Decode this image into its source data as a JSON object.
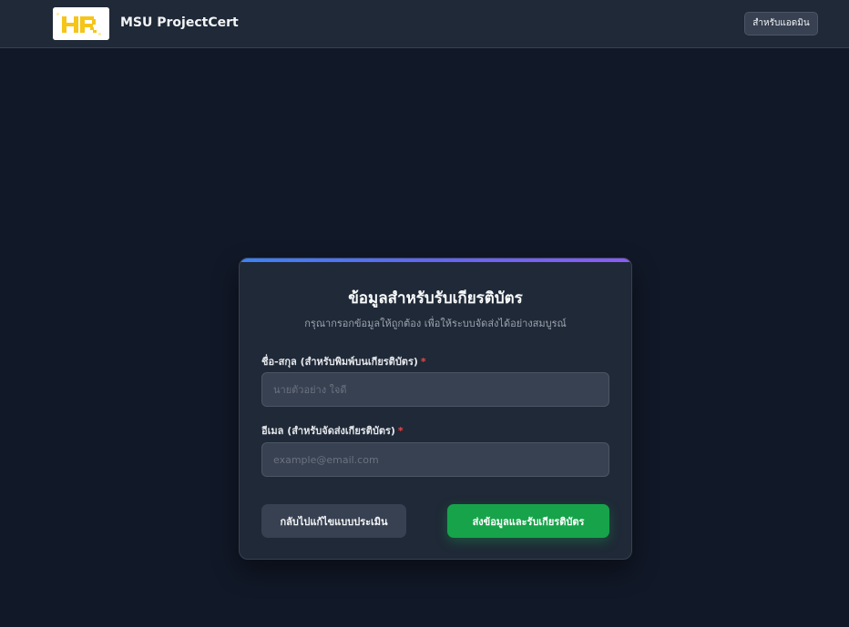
{
  "header": {
    "brand": "MSU ProjectCert",
    "logo_text": "HR",
    "admin_button": "สำหรับแอดมิน"
  },
  "form": {
    "title": "ข้อมูลสำหรับรับเกียรติบัตร",
    "subtitle": "กรุณากรอกข้อมูลให้ถูกต้อง เพื่อให้ระบบจัดส่งได้อย่างสมบูรณ์",
    "name_label": "ชื่อ-สกุล (สำหรับพิมพ์บนเกียรติบัตร)",
    "name_placeholder": "นายตัวอย่าง ใจดี",
    "name_value": "",
    "email_label": "อีเมล (สำหรับจัดส่งเกียรติบัตร)",
    "email_placeholder": "example@email.com",
    "email_value": "",
    "required_mark": "*",
    "back_button": "กลับไปแก้ไขแบบประเมิน",
    "submit_button": "ส่งข้อมูลและรับเกียรติบัตร"
  },
  "colors": {
    "background": "#111827",
    "card": "#1f2937",
    "accent_gradient": [
      "#3b82f6",
      "#8b5cf6"
    ],
    "submit": "#16a34a",
    "required": "#ef4444",
    "logo_yellow": "#f5c518"
  }
}
